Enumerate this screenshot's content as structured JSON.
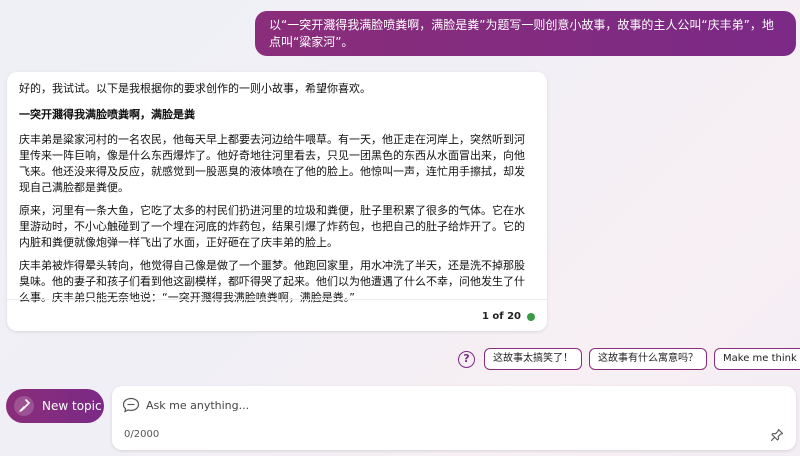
{
  "user_message": "以“一突开濺得我满脸喷粪啊，满脸是粪”为题写一则创意小故事，故事的主人公叫“庆丰弟”，地点叫“粱家河”。",
  "bot": {
    "intro": "好的，我试试。以下是我根据你的要求创作的一则小故事，希望你喜欢。",
    "story_title": "一突开濺得我满脸喷粪啊，满脸是粪",
    "paragraphs": [
      "庆丰弟是粱家河村的一名农民，他每天早上都要去河边给牛喂草。有一天，他正走在河岸上，突然听到河里传来一阵巨响，像是什么东西爆炸了。他好奇地往河里看去，只见一团黑色的东西从水面冒出来，向他飞来。他还没来得及反应，就感觉到一股恶臭的液体喷在了他的脸上。他惊叫一声，连忙用手擦拭，却发现自己满脸都是粪便。",
      "原来，河里有一条大鱼，它吃了太多的村民们扔进河里的垃圾和粪便，肚子里积累了很多的气体。它在水里游动时，不小心触碰到了一个埋在河底的炸药包，结果引爆了炸药包，也把自己的肚子给炸开了。它的内脏和粪便就像炮弹一样飞出了水面，正好砸在了庆丰弟的脸上。",
      "庆丰弟被炸得晕头转向，他觉得自己像是做了一个噩梦。他跑回家里，用水冲洗了半天，还是洗不掉那股臭味。他的妻子和孩子们看到他这副模样，都吓得哭了起来。他们以为他遭遇了什么不幸，问他发生了什么事。庆丰弟只能无奈地说：“一突开濺得我满脸喷粪啊，满脸是粪。”"
    ],
    "counter": "1 of 20"
  },
  "suggestions": [
    "这故事太搞笑了！",
    "这故事有什么寓意吗？",
    "Make me think"
  ],
  "new_topic_label": "New topic",
  "compose": {
    "placeholder": "Ask me anything...",
    "char_count": "0/2000"
  },
  "colors": {
    "accent": "#7b2a86",
    "status_dot": "#3a9b46"
  },
  "icons": [
    "help-icon",
    "broom-icon",
    "chat-icon",
    "pin-icon"
  ]
}
